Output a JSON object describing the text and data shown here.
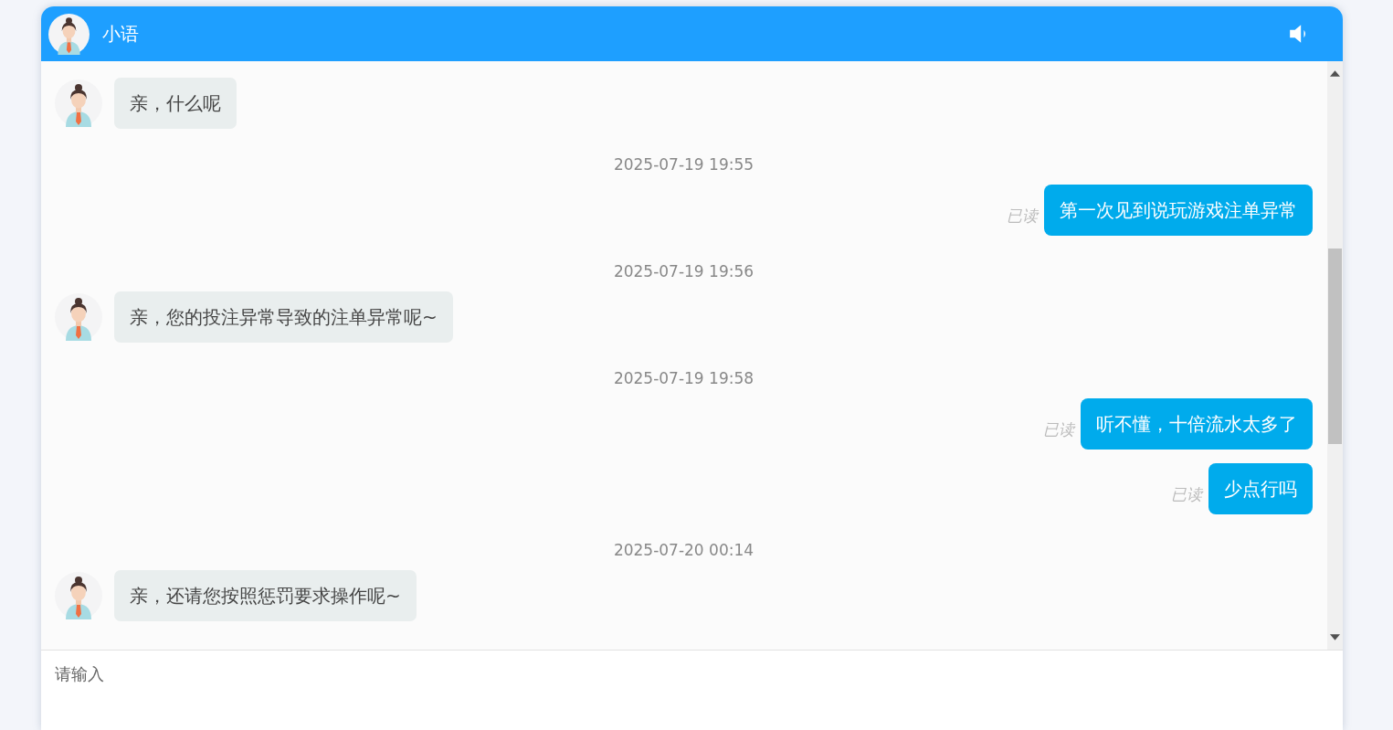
{
  "header": {
    "title": "小语"
  },
  "messages": [
    {
      "kind": "agent",
      "text": "亲，什么呢"
    },
    {
      "kind": "time",
      "text": "2025-07-19 19:55"
    },
    {
      "kind": "user",
      "text": "第一次见到说玩游戏注单异常",
      "status": "已读"
    },
    {
      "kind": "time",
      "text": "2025-07-19 19:56"
    },
    {
      "kind": "agent",
      "text": "亲，您的投注异常导致的注单异常呢~"
    },
    {
      "kind": "time",
      "text": "2025-07-19 19:58"
    },
    {
      "kind": "user",
      "text": "听不懂，十倍流水太多了",
      "status": "已读"
    },
    {
      "kind": "user",
      "text": "少点行吗",
      "status": "已读"
    },
    {
      "kind": "time",
      "text": "2025-07-20 00:14"
    },
    {
      "kind": "agent",
      "text": "亲，还请您按照惩罚要求操作呢~"
    }
  ],
  "input": {
    "placeholder": "请输入"
  }
}
